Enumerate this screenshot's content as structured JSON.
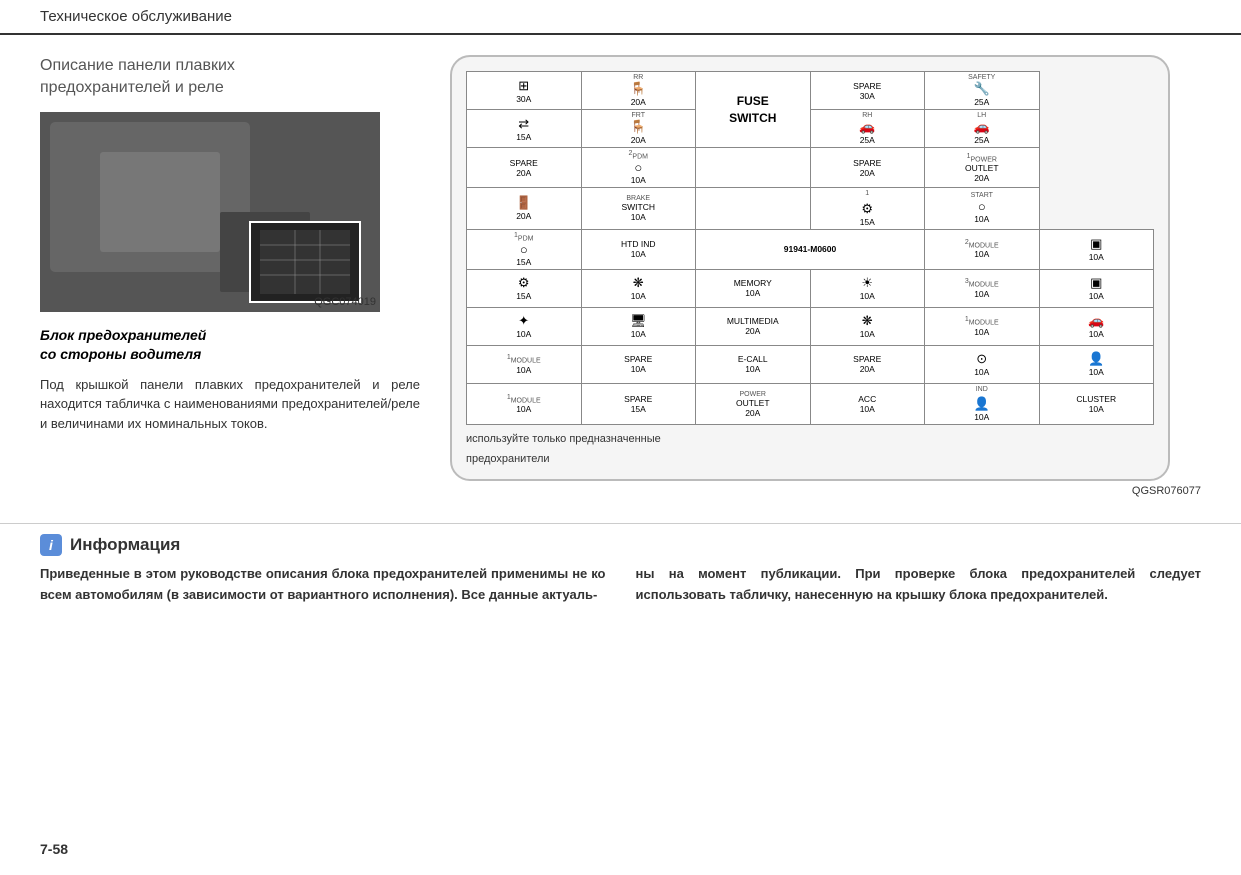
{
  "header": {
    "title": "Техническое обслуживание"
  },
  "left": {
    "section_title": "Описание панели плавких\nпредохранителей и реле",
    "photo_code": "QGC074019",
    "caption": "Блок предохранителей\nсо стороны водителя",
    "body_text": "Под крышкой панели плавких предохранителей и реле находится табличка с наименованиями предохранителей/реле  и  величинами  их номинальных токов."
  },
  "diagram": {
    "part_number": "91941-M0600",
    "note_line1": "используйте только предназначенные",
    "note_line2": "предохранители",
    "code": "QGSR076077"
  },
  "info": {
    "icon": "i",
    "title": "Информация",
    "text_left": "Приведенные в этом руководстве описания блока предохранителей применимы не ко всем автомобилям (в зависимости от вариантного исполнения). Все данные актуаль-",
    "text_right": "ны на момент публикации. При проверке блока предохранителей следует  использовать  табличку, нанесенную на крышку блока предохранителей."
  },
  "page": "7-58"
}
